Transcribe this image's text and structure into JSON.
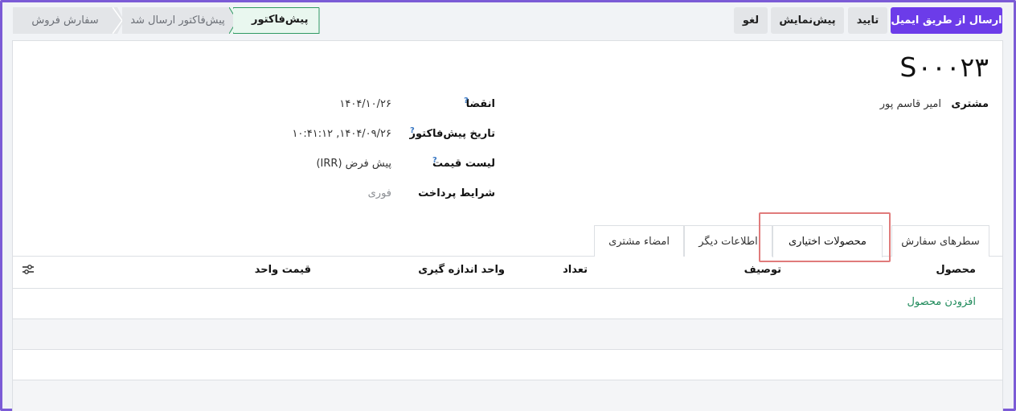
{
  "breadcrumb": {
    "items": [
      "سفارش فروش",
      "پیش‌فاکتور ارسال شد"
    ],
    "current": "پیش‌فاکتور"
  },
  "actions": {
    "send_email": "ارسال از طریق ایمیل",
    "confirm": "تایید",
    "preview": "پیش‌نمایش",
    "cancel": "لغو"
  },
  "record": {
    "title": "S۰۰۰۲۳",
    "customer_label": "مشتری",
    "customer_value": "امیر قاسم پور",
    "expiration_label": "انقضا",
    "expiration_value": "۱۴۰۴/۱۰/۲۶",
    "quote_date_label": "تاریخ پیش‌فاکتور",
    "quote_date_value": "۱۴۰۴/۰۹/۲۶, ۱۰:۴۱:۱۲",
    "pricelist_label": "لیست قیمت",
    "pricelist_value": "پیش فرض (IRR)",
    "payment_terms_label": "شرایط پرداخت",
    "payment_terms_value": "فوری",
    "help_mark": "?"
  },
  "tabs": [
    {
      "label": "سطرهای سفارش"
    },
    {
      "label": "محصولات اختیاری"
    },
    {
      "label": "اطلاعات دیگر"
    },
    {
      "label": "امضاء مشتری"
    }
  ],
  "table": {
    "headers": [
      "محصول",
      "توصیف",
      "تعداد",
      "واحد اندازه گیری",
      "قیمت واحد"
    ],
    "add_product": "افزودن محصول"
  },
  "colors": {
    "primary": "#6c3ce9",
    "breadcrumb_current_bg": "#e9f7ef",
    "link_green": "#1e8a5a",
    "highlight": "#e07b7b"
  }
}
